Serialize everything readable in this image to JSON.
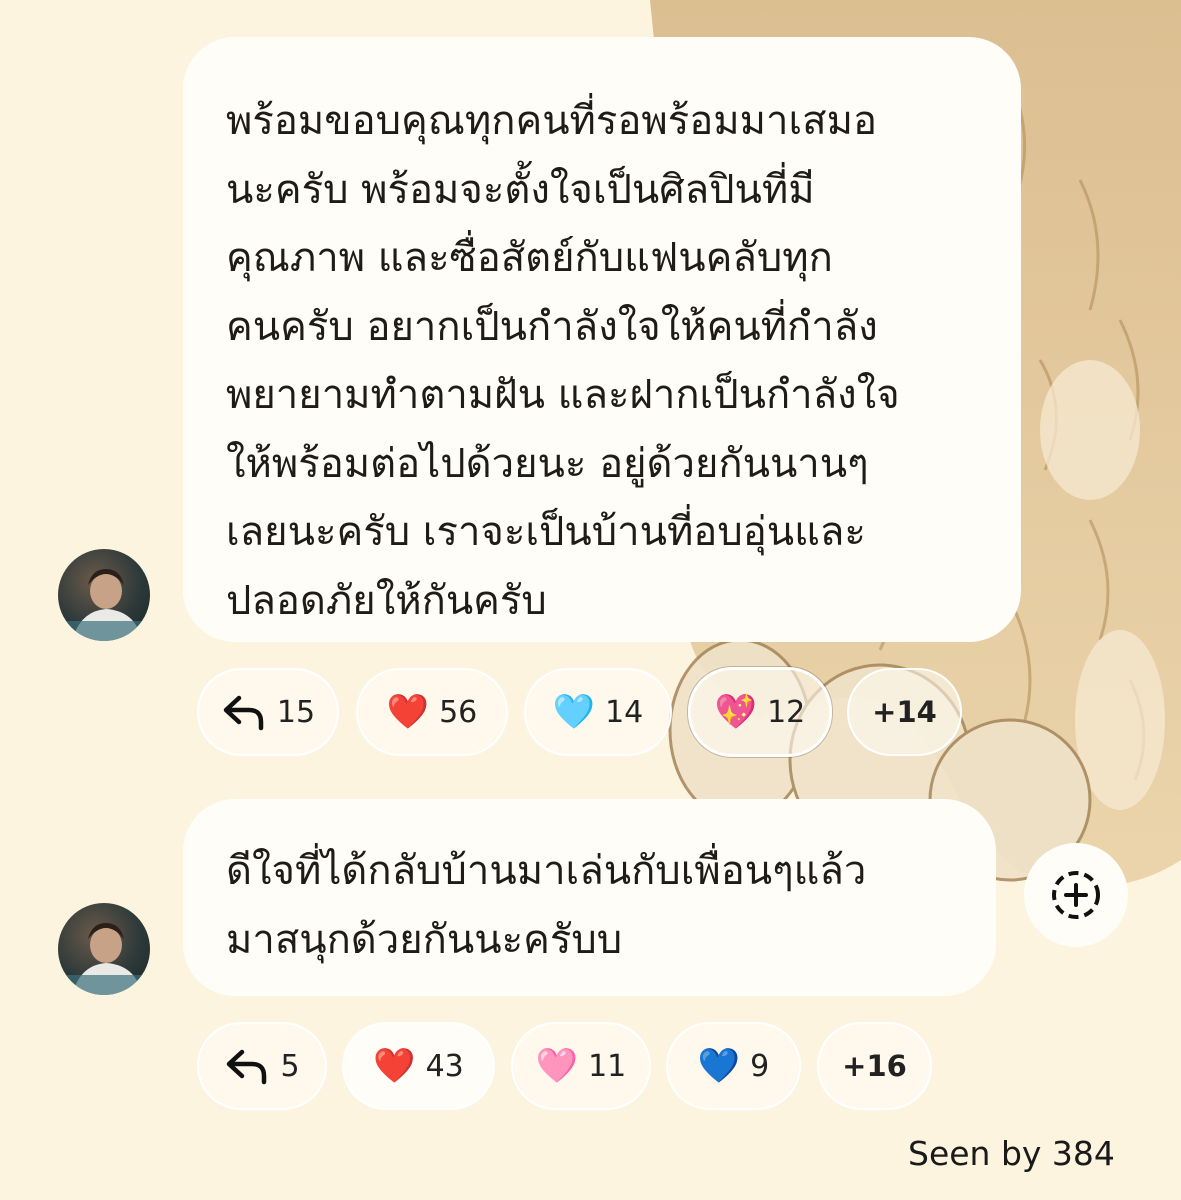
{
  "messages": [
    {
      "lines": [
        "พร้อมขอบคุณทุกคนที่รอพร้อมมาเสมอ",
        "นะครับ พร้อมจะตั้งใจเป็นศิลปินที่มี",
        "คุณภาพ และซื่อสัตย์กับแฟนคลับทุก",
        "คนครับ อยากเป็นกำลังใจให้คนที่กำลัง",
        "พยายามทำตามฝัน และฝากเป็นกำลังใจ",
        "ให้พร้อมต่อไปด้วยนะ อยู่ด้วยกันนานๆ",
        "เลยนะครับ เราจะเป็นบ้านที่อบอุ่นและ",
        "ปลอดภัยให้กันครับ"
      ],
      "replies": {
        "icon": "reply-arrow-icon",
        "count": "15"
      },
      "reactions": [
        {
          "emoji": "❤️",
          "count": "56",
          "icon": "red-heart-icon"
        },
        {
          "emoji": "🩵",
          "count": "14",
          "icon": "light-blue-heart-icon"
        },
        {
          "emoji": "💖",
          "count": "12",
          "icon": "sparkling-heart-icon",
          "selected": true
        }
      ],
      "more": "+14"
    },
    {
      "lines": [
        "ดีใจที่ได้กลับบ้านมาเล่นกับเพื่อนๆแล้ว",
        "มาสนุกด้วยกันนะครับบ"
      ],
      "replies": {
        "icon": "reply-arrow-icon",
        "count": "5"
      },
      "reactions": [
        {
          "emoji": "❤️",
          "count": "43",
          "icon": "red-heart-icon"
        },
        {
          "emoji": "🩷",
          "count": "11",
          "icon": "pink-heart-icon"
        },
        {
          "emoji": "💙",
          "count": "9",
          "icon": "blue-heart-icon"
        }
      ],
      "more": "+16"
    }
  ],
  "add_reaction_icon": "add-reaction-icon",
  "seen_by": "Seen by 384",
  "colors": {
    "background": "#fdf4e0",
    "bubble": "#fffdf8",
    "text": "#1f1b16"
  }
}
